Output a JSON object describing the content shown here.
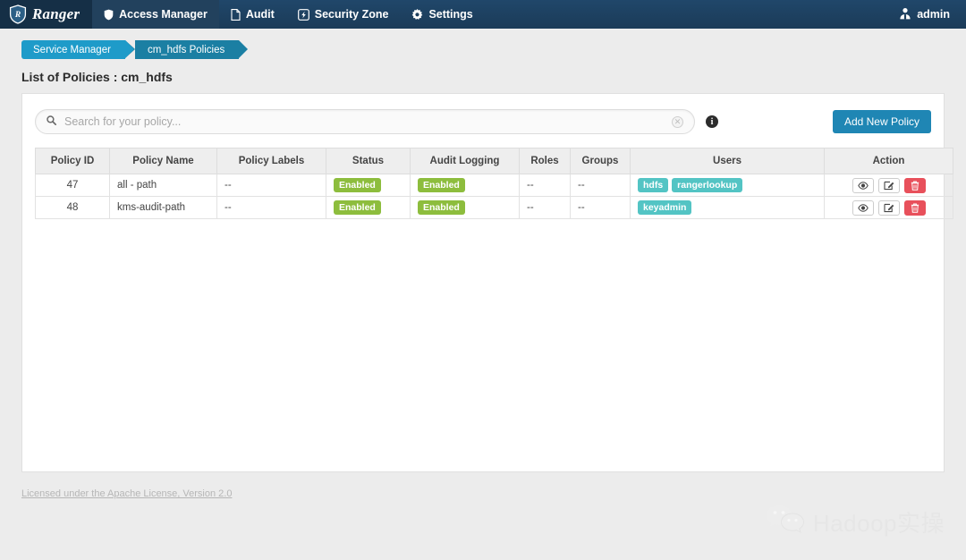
{
  "navbar": {
    "brand": "Ranger",
    "brand_icon": "ranger-shield-logo",
    "items": [
      {
        "label": "Access Manager",
        "icon": "shield-icon",
        "active": true
      },
      {
        "label": "Audit",
        "icon": "file-icon",
        "active": false
      },
      {
        "label": "Security Zone",
        "icon": "bolt-icon",
        "active": false
      },
      {
        "label": "Settings",
        "icon": "gear-icon",
        "active": false
      }
    ],
    "user": {
      "label": "admin",
      "icon": "user-icon"
    }
  },
  "breadcrumb": {
    "items": [
      {
        "label": "Service Manager"
      },
      {
        "label": "cm_hdfs Policies"
      }
    ]
  },
  "page": {
    "title": "List of Policies : cm_hdfs"
  },
  "toolbar": {
    "search": {
      "placeholder": "Search for your policy...",
      "value": "",
      "icon": "search-icon",
      "clear_icon": "clear-icon"
    },
    "info_icon": "info-icon",
    "add_policy_label": "Add New Policy"
  },
  "table": {
    "columns": [
      "Policy ID",
      "Policy Name",
      "Policy Labels",
      "Status",
      "Audit Logging",
      "Roles",
      "Groups",
      "Users",
      "Action"
    ],
    "rows": [
      {
        "id": "47",
        "name": "all - path",
        "labels": "--",
        "status": "Enabled",
        "audit": "Enabled",
        "roles": "--",
        "groups": "--",
        "users": [
          "hdfs",
          "rangerlookup"
        ],
        "actions": [
          "view-icon",
          "edit-icon",
          "delete-icon"
        ]
      },
      {
        "id": "48",
        "name": "kms-audit-path",
        "labels": "--",
        "status": "Enabled",
        "audit": "Enabled",
        "roles": "--",
        "groups": "--",
        "users": [
          "keyadmin"
        ],
        "actions": [
          "view-icon",
          "edit-icon",
          "delete-icon"
        ]
      }
    ]
  },
  "footer": {
    "license": "Licensed under the Apache License, Version 2.0"
  },
  "watermark": {
    "text": "Hadoop实操",
    "icon": "wechat-icon"
  },
  "colors": {
    "navbar_bg": "#1d3f5e",
    "navbar_active": "#22415d",
    "brand_bg": "#152f46",
    "crumb_first": "#1e9bc9",
    "crumb_second": "#1b7fa3",
    "accent_button": "#1f86b4",
    "badge_enabled": "#8dbd3d",
    "tag_user": "#53c4c4",
    "delete_button": "#e8505b",
    "link_blue": "#2a8fc0",
    "page_bg": "#ececec"
  }
}
